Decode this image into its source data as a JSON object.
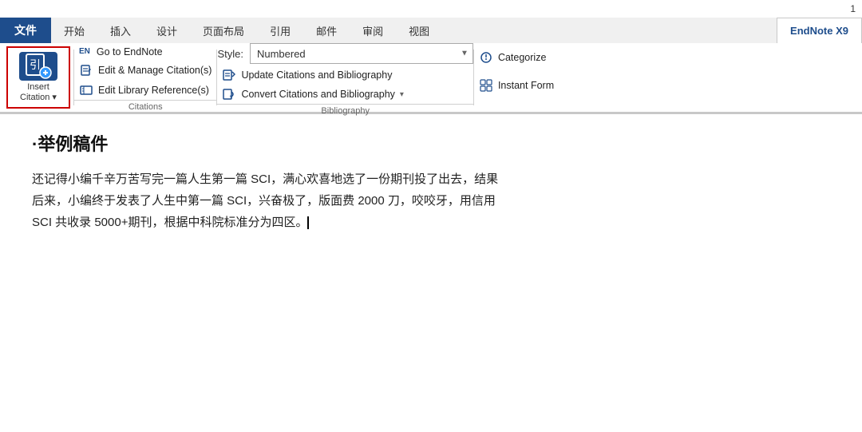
{
  "titlebar": {
    "page_number": "1"
  },
  "tabs": {
    "file": "文件",
    "start": "开始",
    "insert": "插入",
    "design": "设计",
    "layout": "页面布局",
    "references": "引用",
    "mail": "邮件",
    "review": "审阅",
    "view": "视图",
    "endnote": "EndNote X9"
  },
  "ribbon": {
    "insert_citation": {
      "label_line1": "Insert",
      "label_line2": "Citation",
      "dropdown_arrow": "▾"
    },
    "citations_group": {
      "label": "Citations",
      "btn_goto": "Go to EndNote",
      "btn_edit_manage": "Edit & Manage Citation(s)",
      "btn_edit_library": "Edit Library Reference(s)"
    },
    "bibliography_group": {
      "label": "Bibliography",
      "style_label": "Style:",
      "style_value": "Numbered",
      "btn_update": "Update Citations and Bibliography",
      "btn_convert": "Convert Citations and Bibliography"
    },
    "right_group": {
      "btn_categorize": "Categorize",
      "btn_instant": "Instant Form"
    }
  },
  "document": {
    "title": "·举例稿件",
    "paragraph1": "还记得小编千辛万苦写完一篇人生第一篇 SCI，满心欢喜地选了一份期刊投了出去，结果",
    "paragraph2": "后来，小编终于发表了人生中第一篇 SCI，兴奋极了，版面费 2000 刀，咬咬牙，用信用",
    "paragraph3": "SCI 共收录 5000+期刊，根据中科院标准分为四区。"
  },
  "icons": {
    "en_icon": "EN",
    "edit_icon": "✎",
    "library_icon": "📚",
    "update_icon": "🔄",
    "convert_icon": "🔁",
    "categorize_icon": "⚙",
    "instant_icon": "⊞"
  }
}
